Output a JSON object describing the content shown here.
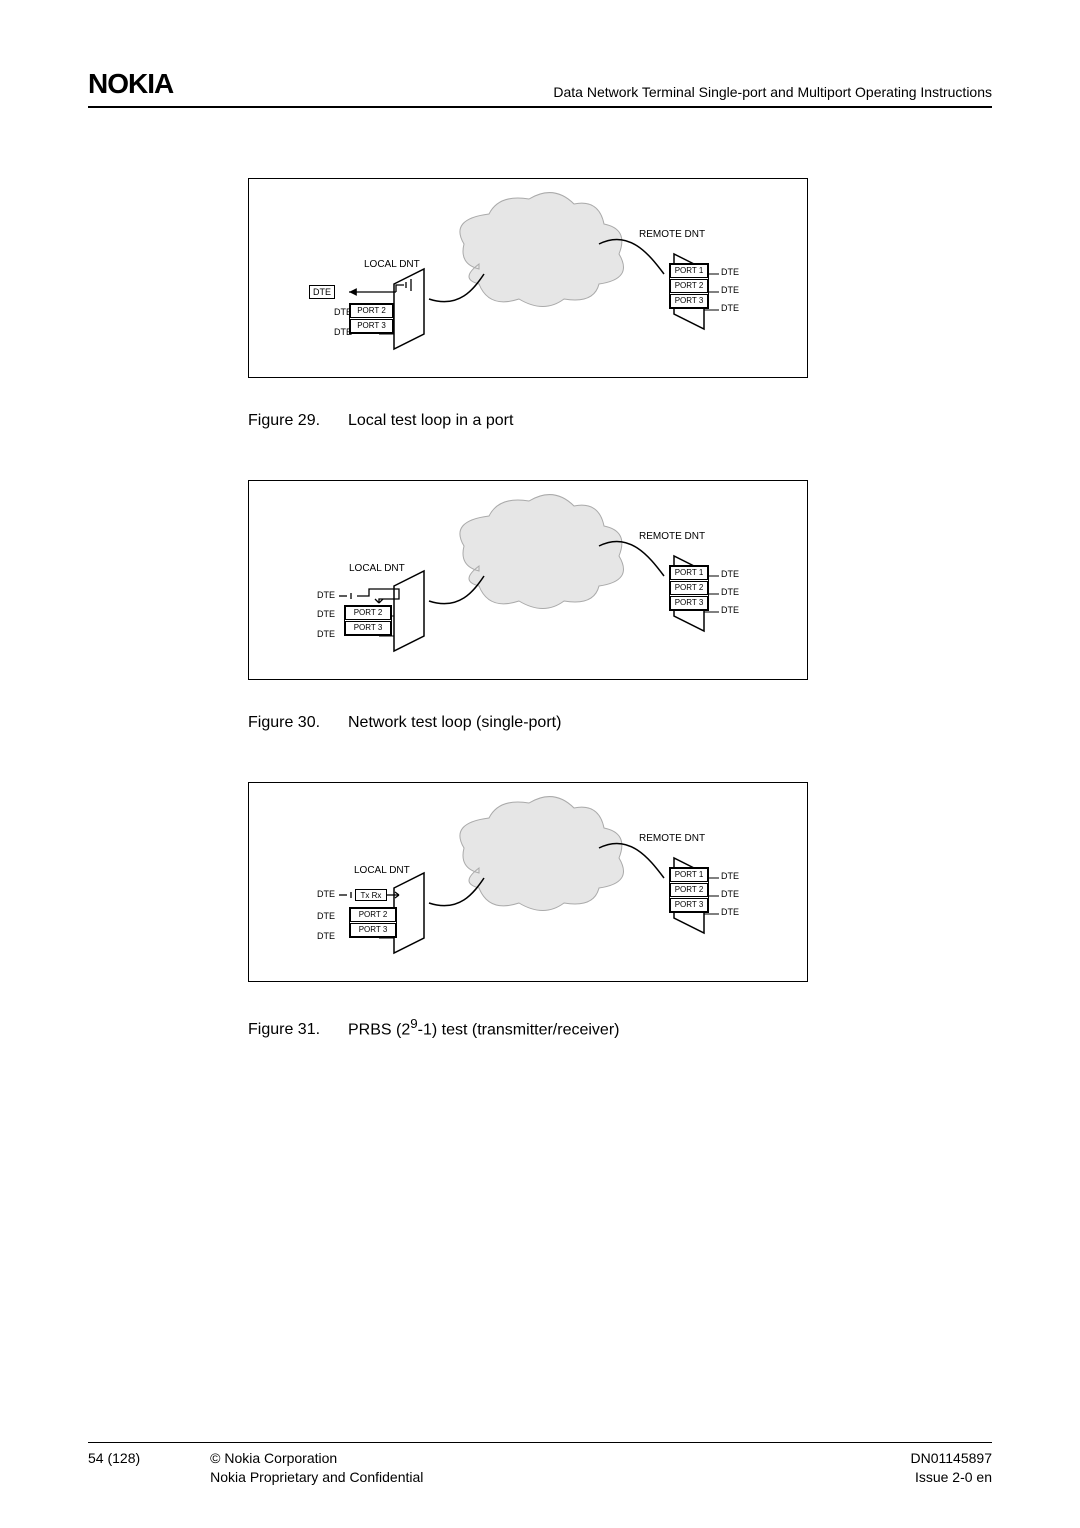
{
  "header": {
    "logo": "NOKIA",
    "title": "Data Network Terminal Single-port and Multiport Operating Instructions"
  },
  "figures": [
    {
      "num": "Figure 29.",
      "caption": "Local test loop in a port"
    },
    {
      "num": "Figure 30.",
      "caption": "Network test loop (single-port)"
    },
    {
      "num": "Figure 31.",
      "caption_prefix": "PRBS (2",
      "caption_sup": "9",
      "caption_suffix": "-1) test (transmitter/receiver)"
    }
  ],
  "diagram": {
    "local_label": "LOCAL DNT",
    "remote_label": "REMOTE DNT",
    "port1": "PORT 1",
    "port2": "PORT 2",
    "port3": "PORT 3",
    "dte": "DTE",
    "txrx": "Tx Rx"
  },
  "footer": {
    "page": "54 (128)",
    "copyright": "© Nokia Corporation",
    "confidential": "Nokia Proprietary and Confidential",
    "docnum": "DN01145897",
    "issue": "Issue 2-0 en"
  }
}
